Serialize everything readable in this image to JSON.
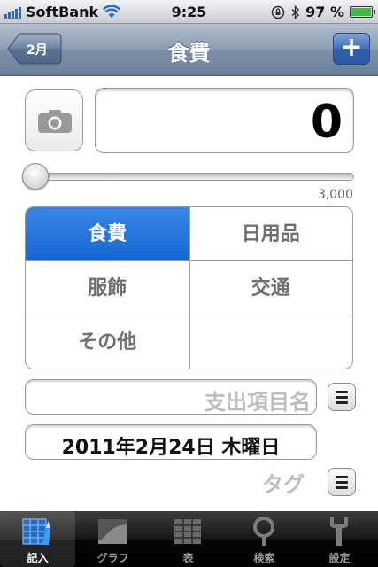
{
  "status_bar": {
    "carrier": "SoftBank",
    "time": "9:25",
    "battery": "97 %"
  },
  "nav": {
    "back_label": "2月",
    "title": "食費",
    "add_label": "+"
  },
  "amount": {
    "value": "0"
  },
  "slider": {
    "max_label": "3,000",
    "value": 0
  },
  "categories": {
    "items": [
      "食費",
      "日用品",
      "服飾",
      "交通",
      "その他",
      ""
    ],
    "selected": "食費"
  },
  "expense_name": {
    "placeholder": "支出項目名"
  },
  "date": {
    "value": "2011年2月24日 木曜日"
  },
  "tag": {
    "label": "タグ"
  },
  "tabs": [
    {
      "label": "記入",
      "icon": "pen-entry-icon",
      "active": true
    },
    {
      "label": "グラフ",
      "icon": "graph-icon",
      "active": false
    },
    {
      "label": "表",
      "icon": "table-icon",
      "active": false
    },
    {
      "label": "検索",
      "icon": "magnifier-icon",
      "active": false
    },
    {
      "label": "設定",
      "icon": "wrench-icon",
      "active": false
    }
  ],
  "colors": {
    "selected_category": "#1565d3",
    "nav_bar": "#7d8fa7",
    "add_button": "#3e6fb8",
    "battery_fill": "#37c335"
  }
}
